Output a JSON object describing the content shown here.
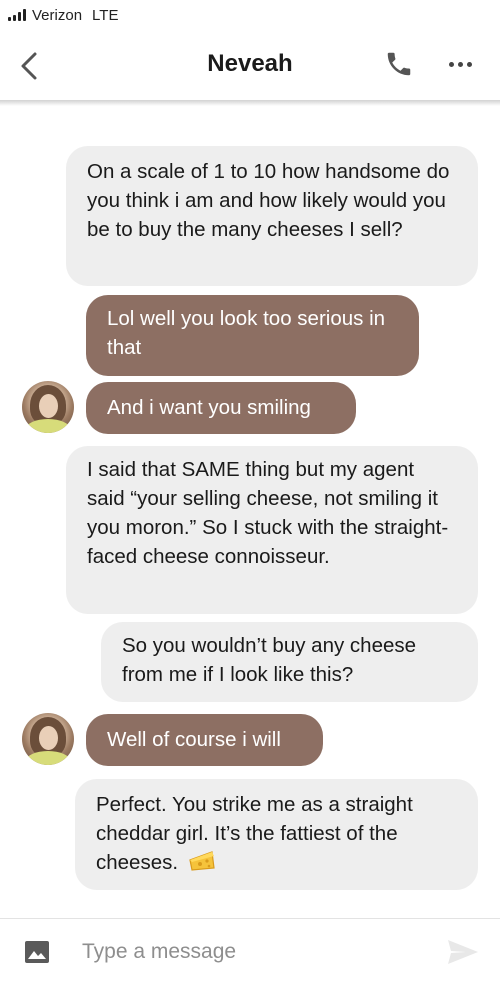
{
  "status_bar": {
    "carrier": "Verizon",
    "network": "LTE"
  },
  "header": {
    "contact_name": "Neveah",
    "back_icon": "chevron-left-icon",
    "call_icon": "phone-icon",
    "more_icon": "more-horizontal-icon"
  },
  "messages": [
    {
      "direction": "sent",
      "text": "On a scale of 1 to 10 how handsome do you think i am and how likely would you be to buy the many cheeses I sell?"
    },
    {
      "direction": "received",
      "text": "Lol well you look too serious in that"
    },
    {
      "direction": "received",
      "text": "And i want you smiling"
    },
    {
      "direction": "sent",
      "text": "I said that SAME thing but my agent said “your selling cheese, not smiling it you moron.” So I stuck with the straight-faced cheese connoisseur."
    },
    {
      "direction": "sent",
      "text": "So you wouldn’t buy any cheese from me if I look like this?"
    },
    {
      "direction": "received",
      "text": "Well of course i will"
    },
    {
      "direction": "sent",
      "text": "Perfect. You strike me as a straight cheddar girl. It’s the fattiest of the cheeses.",
      "emoji_icon": "cheese-wedge-icon"
    }
  ],
  "composer": {
    "placeholder": "Type a message",
    "value": "",
    "image_icon": "image-icon",
    "send_icon": "send-icon"
  },
  "colors": {
    "sent_bubble": "#eeeeee",
    "received_bubble": "#8d6f63",
    "header_bg": "#ffffff"
  }
}
